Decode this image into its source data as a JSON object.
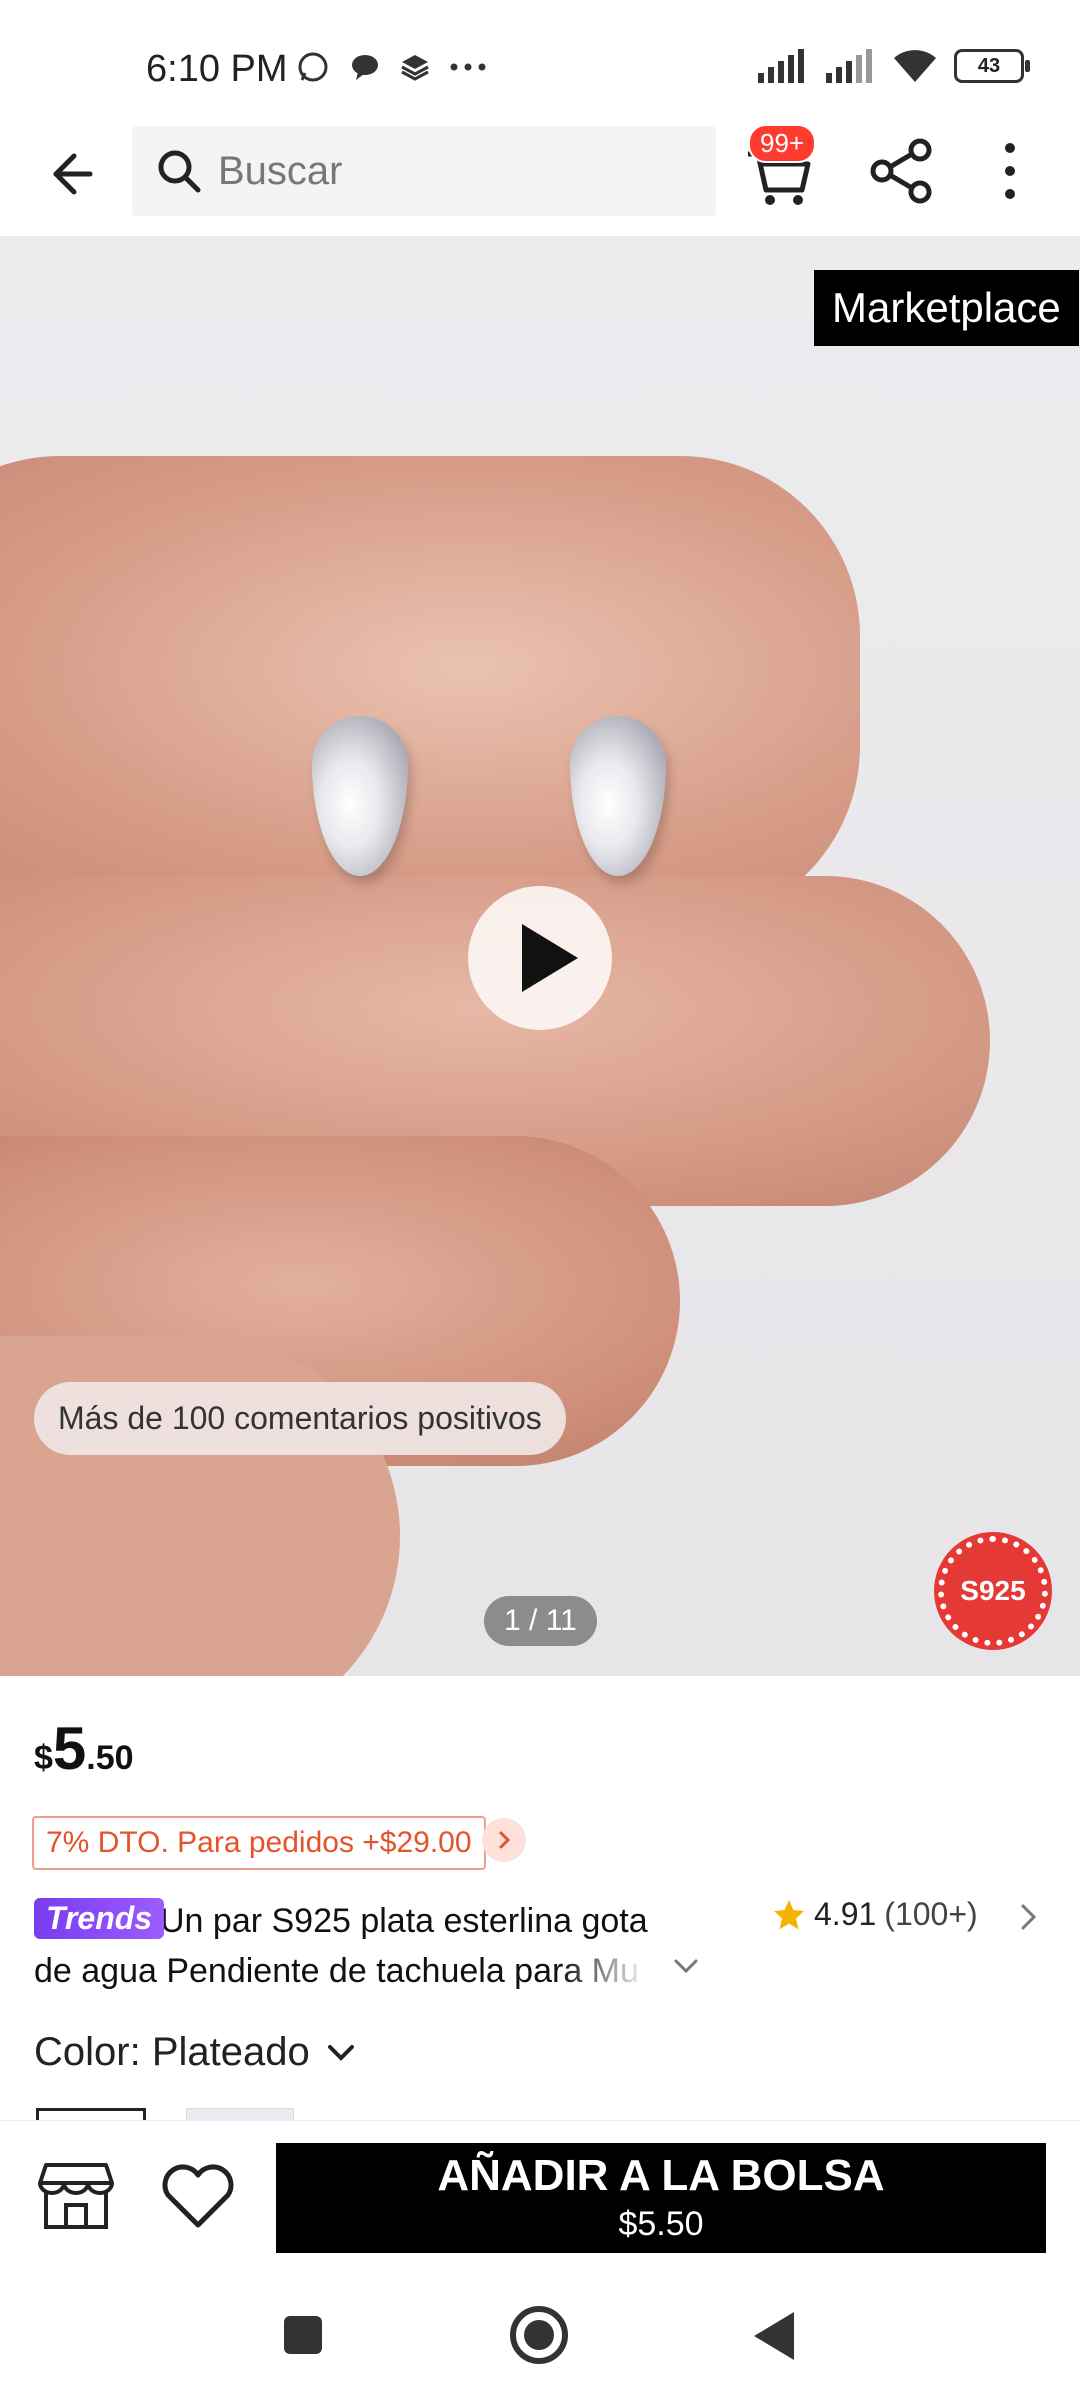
{
  "status_bar": {
    "time": "6:10 PM",
    "battery": "43"
  },
  "header": {
    "search_placeholder": "Buscar",
    "cart_badge": "99+"
  },
  "gallery": {
    "marketplace_label": "Marketplace",
    "review_text": "Más de 100 comentarios positivos",
    "page_indicator": "1 / 11",
    "seal_text": "S925"
  },
  "product": {
    "price_currency": "$",
    "price_integer": "5",
    "price_decimal": ".50",
    "discount": "7% DTO. Para pedidos +$29.00",
    "badge": "Trends",
    "title": "Un par S925 plata esterlina gota de agua Pendiente de tachuela para Mu",
    "rating": "4.91",
    "rating_count": "(100+)",
    "color_label": "Color: Plateado"
  },
  "bottom_bar": {
    "add_to_bag": "AÑADIR A LA BOLSA",
    "add_to_bag_price": "$5.50"
  },
  "colors": {
    "accent": "#e5532c",
    "badge_red": "#ff3b30",
    "trends_purple": "#7a3cf0",
    "star": "#f5b400"
  }
}
